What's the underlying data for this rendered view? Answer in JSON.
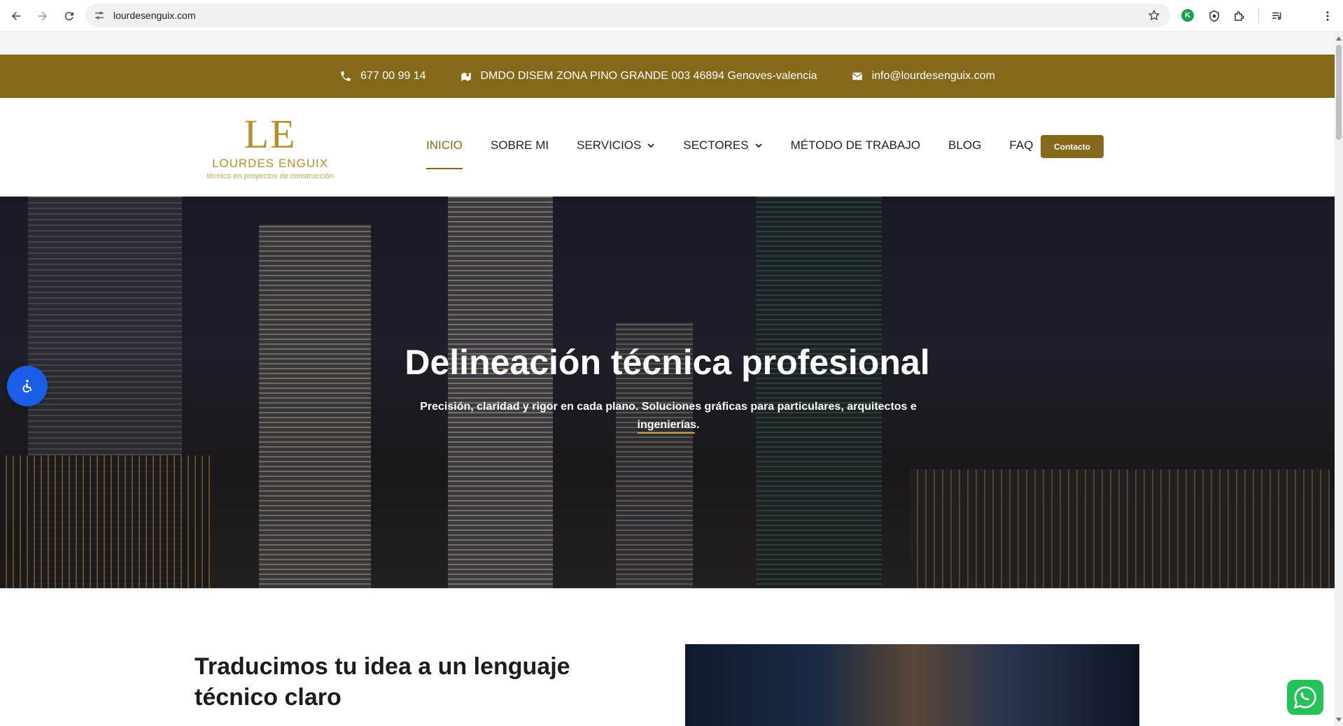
{
  "browser": {
    "url": "lourdesenguix.com",
    "extension_badge": "K"
  },
  "topbar": {
    "phone": "677 00 99 14",
    "address": "DMDO DISEM ZONA PINO GRANDE 003 46894 Genoves-valencia",
    "email": "info@lourdesenguix.com"
  },
  "logo": {
    "mark": "LE",
    "name": "LOURDES ENGUIX",
    "tagline": "técnico en proyectos de construcción"
  },
  "menu": {
    "items": [
      {
        "label": "INICIO",
        "active": true
      },
      {
        "label": "SOBRE MI"
      },
      {
        "label": "SERVICIOS",
        "dropdown": true
      },
      {
        "label": "SECTORES",
        "dropdown": true
      },
      {
        "label": "MÉTODO DE TRABAJO"
      },
      {
        "label": "BLOG"
      },
      {
        "label": "FAQ"
      }
    ],
    "cta": "Contacto"
  },
  "hero": {
    "title": "Delineación técnica profesional",
    "subtitle": "Precisión, claridad y rigor en cada plano. Soluciones gráficas para particulares, arquitectos e ingenierías."
  },
  "section": {
    "heading": "Traducimos tu idea a un lenguaje técnico claro"
  },
  "colors": {
    "brand": "#85681a",
    "accessibility": "#1a5ee8",
    "whatsapp": "#25c25a"
  },
  "icons": [
    "back-icon",
    "forward-icon",
    "reload-icon",
    "site-settings-icon",
    "bookmark-star-icon",
    "shield-icon",
    "puzzle-icon",
    "media-icon",
    "more-icon",
    "phone-icon",
    "map-icon",
    "envelope-icon",
    "chevron-down-icon",
    "accessibility-icon",
    "whatsapp-icon"
  ]
}
